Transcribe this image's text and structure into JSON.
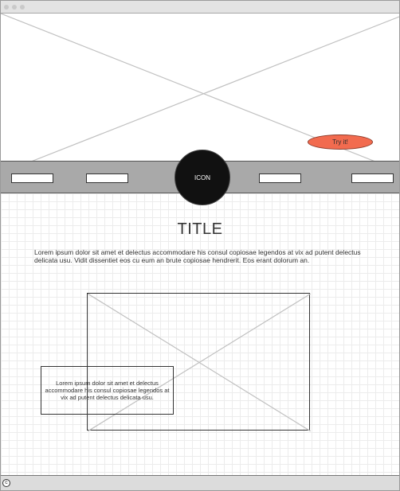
{
  "hero": {
    "cta_label": "Try it!"
  },
  "navbar": {
    "items": [
      "",
      "",
      "",
      ""
    ],
    "icon_label": "ICON"
  },
  "main": {
    "title": "TITLE",
    "intro": "Lorem ipsum dolor sit amet et delectus accommodare his consul copiosae legendos at vix ad putent delectus delicata usu. Vidit dissentiet eos cu eum an brute copiosae hendrerit. Eos erant dolorum an.",
    "caption": "Lorem ipsum dolor sit amet et delectus accommodare his consul copiosae legendos at vix ad putent delectus delicata usu."
  },
  "footer": {
    "copyright_symbol": "c"
  },
  "colors": {
    "cta": "#f26b4f",
    "navbar": "#a9a9a9",
    "icon_circle": "#111111"
  }
}
